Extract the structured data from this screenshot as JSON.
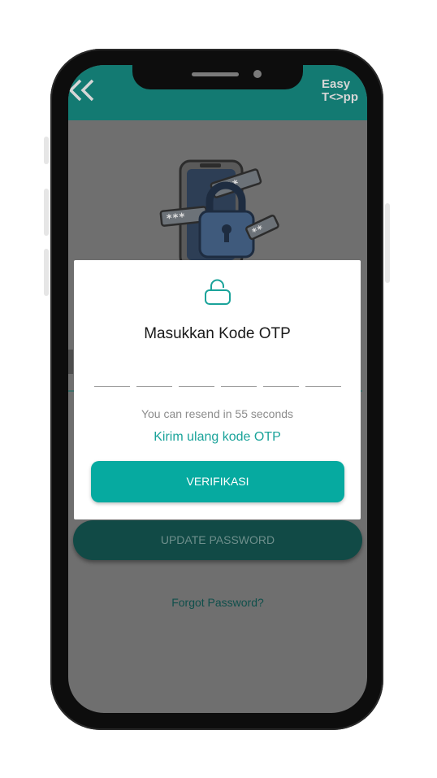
{
  "header": {
    "back_icon": "double-chevron-left-icon",
    "logo_line1": "Easy",
    "logo_line2": "T<>pp",
    "color": "#137a72"
  },
  "background": {
    "update_button_label": "UPDATE PASSWORD",
    "forgot_link": "Forgot Password?"
  },
  "dialog": {
    "icon": "unlock-icon",
    "title": "Masukkan Kode OTP",
    "otp_slots": [
      "",
      "",
      "",
      "",
      "",
      ""
    ],
    "resend_info": "You can resend in 55 seconds",
    "resend_link": "Kirim ulang kode OTP",
    "verify_label": "VERIFIKASI",
    "accent": "#06aaa0"
  }
}
